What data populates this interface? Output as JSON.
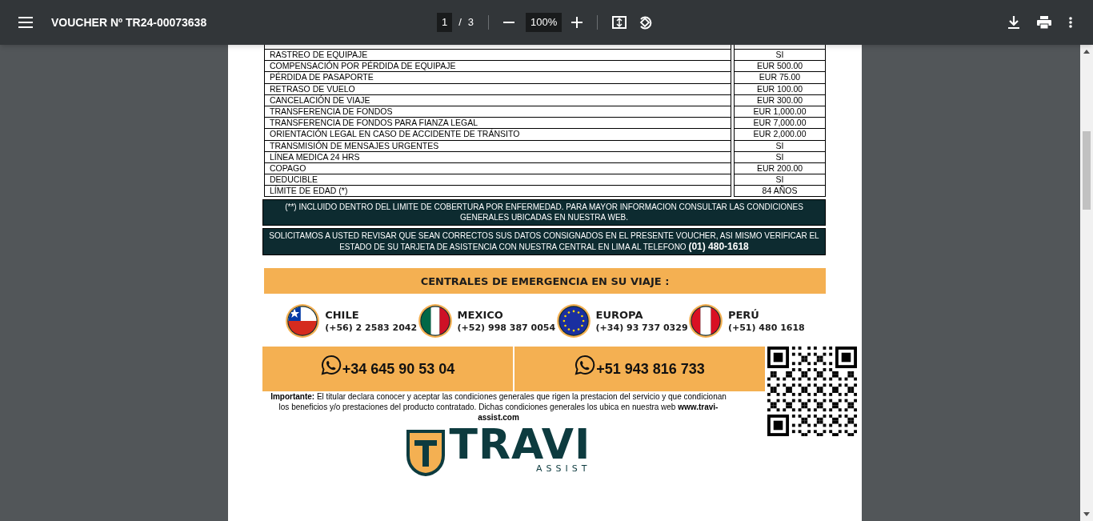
{
  "toolbar": {
    "title": "VOUCHER Nº TR24-00073638",
    "page_current": "1",
    "page_separator": "/",
    "page_total": "3",
    "zoom": "100%"
  },
  "coverage_table": {
    "rows": [
      {
        "benefit": "RASTREO DE EQUIPAJE",
        "value": "SI"
      },
      {
        "benefit": "COMPENSACIÓN POR PÉRDIDA DE EQUIPAJE",
        "value": "EUR 500.00"
      },
      {
        "benefit": "PÉRDIDA DE PASAPORTE",
        "value": "EUR 75.00"
      },
      {
        "benefit": "RETRASO DE VUELO",
        "value": "EUR 100.00"
      },
      {
        "benefit": "CANCELACIÓN DE VIAJE",
        "value": "EUR 300.00"
      },
      {
        "benefit": "TRANSFERENCIA DE FONDOS",
        "value": "EUR 1,000.00"
      },
      {
        "benefit": "TRANSFERENCIA DE FONDOS PARA FIANZA LEGAL",
        "value": "EUR 7,000.00"
      },
      {
        "benefit": "ORIENTACIÓN LEGAL EN CASO DE ACCIDENTE DE TRÁNSITO",
        "value": "EUR 2,000.00"
      },
      {
        "benefit": "TRANSMISIÓN DE MENSAJES URGENTES",
        "value": "SI"
      },
      {
        "benefit": "LÍNEA MEDICA 24 HRS",
        "value": "SI"
      },
      {
        "benefit": "COPAGO",
        "value": "EUR 200.00"
      },
      {
        "benefit": "DEDUCIBLE",
        "value": "SI"
      },
      {
        "benefit": "LÍMITE DE EDAD (*)",
        "value": "84 AÑOS"
      }
    ]
  },
  "notices": [
    "(**) INCLUIDO DENTRO DEL LIMITE DE COBERTURA POR ENFERMEDAD. PARA MAYOR INFORMACION CONSULTAR LAS CONDICIONES GENERALES UBICADAS EN NUESTRA WEB.",
    "SOLICITAMOS A USTED REVISAR QUE SEAN CORRECTOS SUS DATOS CONSIGNADOS EN EL PRESENTE VOUCHER, ASI MISMO VERIFICAR EL ESTADO DE SU TARJETA DE ASISTENCIA CON NUESTRA CENTRAL EN LIMA AL TELEFONO **(01) 480-1618**"
  ],
  "emergency": {
    "heading": "CENTRALES DE EMERGENCIA EN SU VIAJE :",
    "centers": [
      {
        "kind": "chile",
        "country": "CHILE",
        "phone": "(+56) 2 2583 2042"
      },
      {
        "kind": "mexico",
        "country": "MEXICO",
        "phone": "(+52) 998 387 0054"
      },
      {
        "kind": "europe",
        "country": "EUROPA",
        "phone": "(+34) 93 737 0329"
      },
      {
        "kind": "peru",
        "country": "PERÚ",
        "phone": "(+51) 480 1618"
      }
    ]
  },
  "whatsapp_numbers": [
    "+34 645 90 53 04",
    "+51 943 816 733"
  ],
  "important": "**Importante:** El titular declara conocer y aceptar las condiciones generales que rigen la prestacion del servicio y que condicionan los beneficios y/o prestaciones del producto contratado. Dichas condiciones generales los ubica en nuestra web **www.travi-assist.com**",
  "logo": {
    "name": "TRAVI",
    "tagline": "ASSIST"
  }
}
